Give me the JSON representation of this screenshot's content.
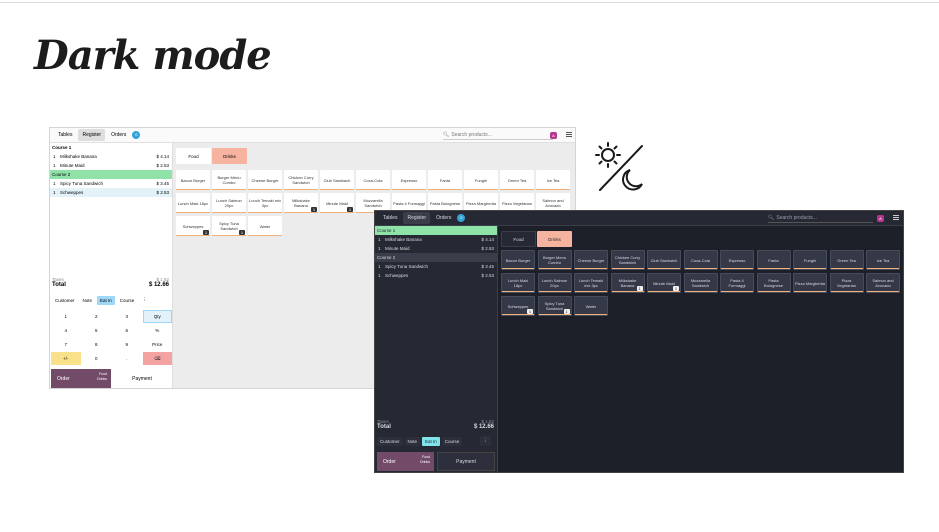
{
  "title": "Dark mode",
  "nav": {
    "tabs": [
      "Tables",
      "Register",
      "Orders"
    ],
    "orders_badge": "0",
    "search_placeholder": "Search products...",
    "profile_badge": "A"
  },
  "categories": [
    "Food",
    "Drinks"
  ],
  "order": {
    "course1": "Course 1",
    "course2": "Course 2",
    "lines": [
      {
        "qty": "1",
        "name": "Milkshake Banana",
        "price": "$ 4.14"
      },
      {
        "qty": "1",
        "name": "Minute Maid",
        "price": "$ 2.53"
      },
      {
        "qty": "1",
        "name": "Spicy Tuna Sandwich",
        "price": "$ 3.45"
      },
      {
        "qty": "1",
        "name": "Schweppes",
        "price": "$ 2.53"
      }
    ],
    "taxes_label": "Taxes",
    "taxes_value": "$ 1.62",
    "total_label": "Total",
    "total_value": "$ 12.66"
  },
  "actions": [
    "Customer",
    "Note",
    "Eat In",
    "Course"
  ],
  "more_icon": "⋮",
  "numpad": [
    "1",
    "2",
    "3",
    "Qty",
    "4",
    "5",
    "6",
    "%",
    "7",
    "8",
    "9",
    "Price",
    "+/-",
    "0",
    ".",
    "⌫"
  ],
  "buttons": {
    "order": "Order",
    "order_food": "Food",
    "order_drinks": "Drinks",
    "payment": "Payment"
  },
  "products": [
    {
      "name": "Bacon Burger"
    },
    {
      "name": "Burger Menu Combo"
    },
    {
      "name": "Cheese Burger"
    },
    {
      "name": "Chicken Curry Sandwich"
    },
    {
      "name": "Club Sandwich"
    },
    {
      "name": "Coca-Cola"
    },
    {
      "name": "Espresso"
    },
    {
      "name": "Fanta"
    },
    {
      "name": "Funghi"
    },
    {
      "name": "Green Tea"
    },
    {
      "name": "Ice Tea"
    },
    {
      "name": "Lunch Maki 18pc"
    },
    {
      "name": "Lunch Salmon 20pc"
    },
    {
      "name": "Lunch Temaki mix 3pc"
    },
    {
      "name": "Milkshake Banana",
      "qty": "1"
    },
    {
      "name": "Minute Maid",
      "qty": "1"
    },
    {
      "name": "Mozzarella Sandwich"
    },
    {
      "name": "Pasta 4 Formaggi"
    },
    {
      "name": "Pasta Bolognese"
    },
    {
      "name": "Pizza Margherita"
    },
    {
      "name": "Pizza Vegetarian"
    },
    {
      "name": "Salmon and Avocado"
    },
    {
      "name": "Schweppes",
      "qty": "1"
    },
    {
      "name": "Spicy Tuna Sandwich",
      "qty": "1"
    },
    {
      "name": "Water"
    }
  ],
  "colors": {
    "accent_purple": "#714b67",
    "course_green": "#8fe3a9",
    "eatin_blue": "#9ed7f7",
    "drinks_salmon": "#f6b3a0",
    "dark_bg": "#1e2029"
  },
  "icons": {
    "theme_toggle": "sun-moon-icon"
  }
}
